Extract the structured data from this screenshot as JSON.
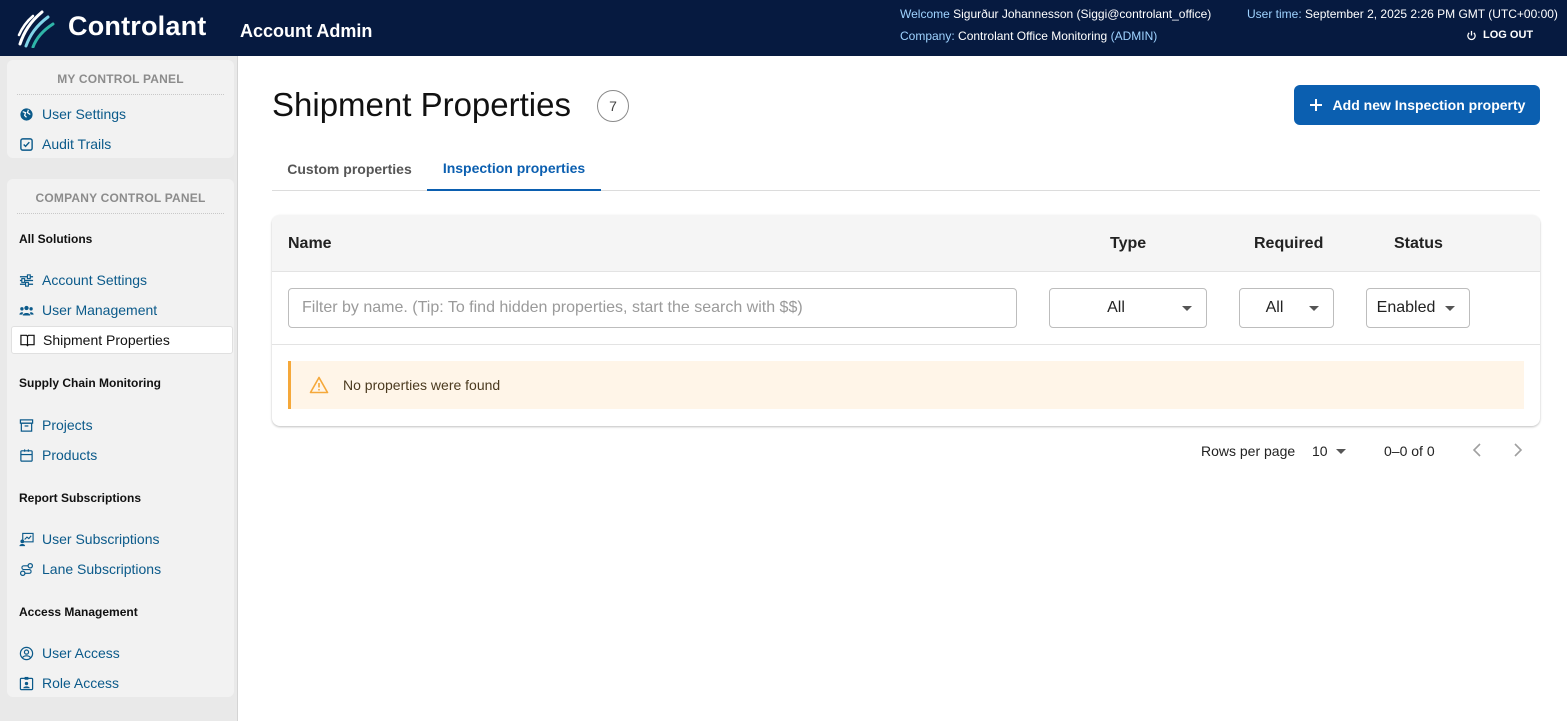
{
  "header": {
    "brand": "Controlant",
    "app_title": "Account Admin",
    "welcome_key": "Welcome",
    "welcome_value": "Sigurður Johannesson (Siggi@controlant_office)",
    "company_key": "Company:",
    "company_value": "Controlant Office Monitoring",
    "company_role": "(ADMIN)",
    "usertime_key": "User time:",
    "usertime_value": "September 2, 2025 2:26 PM GMT (UTC+00:00)",
    "logout_label": "LOG OUT",
    "colors": {
      "bar": "#061a40",
      "accent": "#9fd3ff"
    }
  },
  "sidebar": {
    "my_panel_title": "MY CONTROL PANEL",
    "my_items": [
      {
        "label": "User Settings",
        "icon": "globe-icon"
      },
      {
        "label": "Audit Trails",
        "icon": "checkbox-icon"
      }
    ],
    "company_panel_title": "COMPANY CONTROL PANEL",
    "groups": {
      "all_solutions": "All Solutions",
      "supply_chain": "Supply Chain Monitoring",
      "report_subs": "Report Subscriptions",
      "access": "Access Management"
    },
    "company_items": [
      {
        "label": "Account Settings",
        "icon": "sliders-icon"
      },
      {
        "label": "User Management",
        "icon": "users-icon"
      },
      {
        "label": "Shipment Properties",
        "icon": "book-icon",
        "active": true
      },
      {
        "label": "Projects",
        "icon": "archive-icon"
      },
      {
        "label": "Products",
        "icon": "package-icon"
      },
      {
        "label": "User Subscriptions",
        "icon": "chart-user-icon"
      },
      {
        "label": "Lane Subscriptions",
        "icon": "route-icon"
      },
      {
        "label": "User Access",
        "icon": "user-circle-icon"
      },
      {
        "label": "Role Access",
        "icon": "id-badge-icon"
      }
    ]
  },
  "main": {
    "title": "Shipment Properties",
    "count": "7",
    "add_button": "Add new Inspection property",
    "tabs": [
      {
        "label": "Custom properties",
        "active": false
      },
      {
        "label": "Inspection properties",
        "active": true
      }
    ],
    "table": {
      "columns": [
        "Name",
        "Type",
        "Required",
        "Status"
      ],
      "filter_placeholder": "Filter by name. (Tip: To find hidden properties, start the search with $$)",
      "type_filter": "All",
      "required_filter": "All",
      "status_filter": "Enabled",
      "empty_message": "No properties were found"
    },
    "pagination": {
      "rows_per_page_label": "Rows per page",
      "rows_per_page": "10",
      "range": "0–0 of 0"
    },
    "colors": {
      "primary": "#0b5fb0",
      "warning": "#f5a83a"
    }
  }
}
